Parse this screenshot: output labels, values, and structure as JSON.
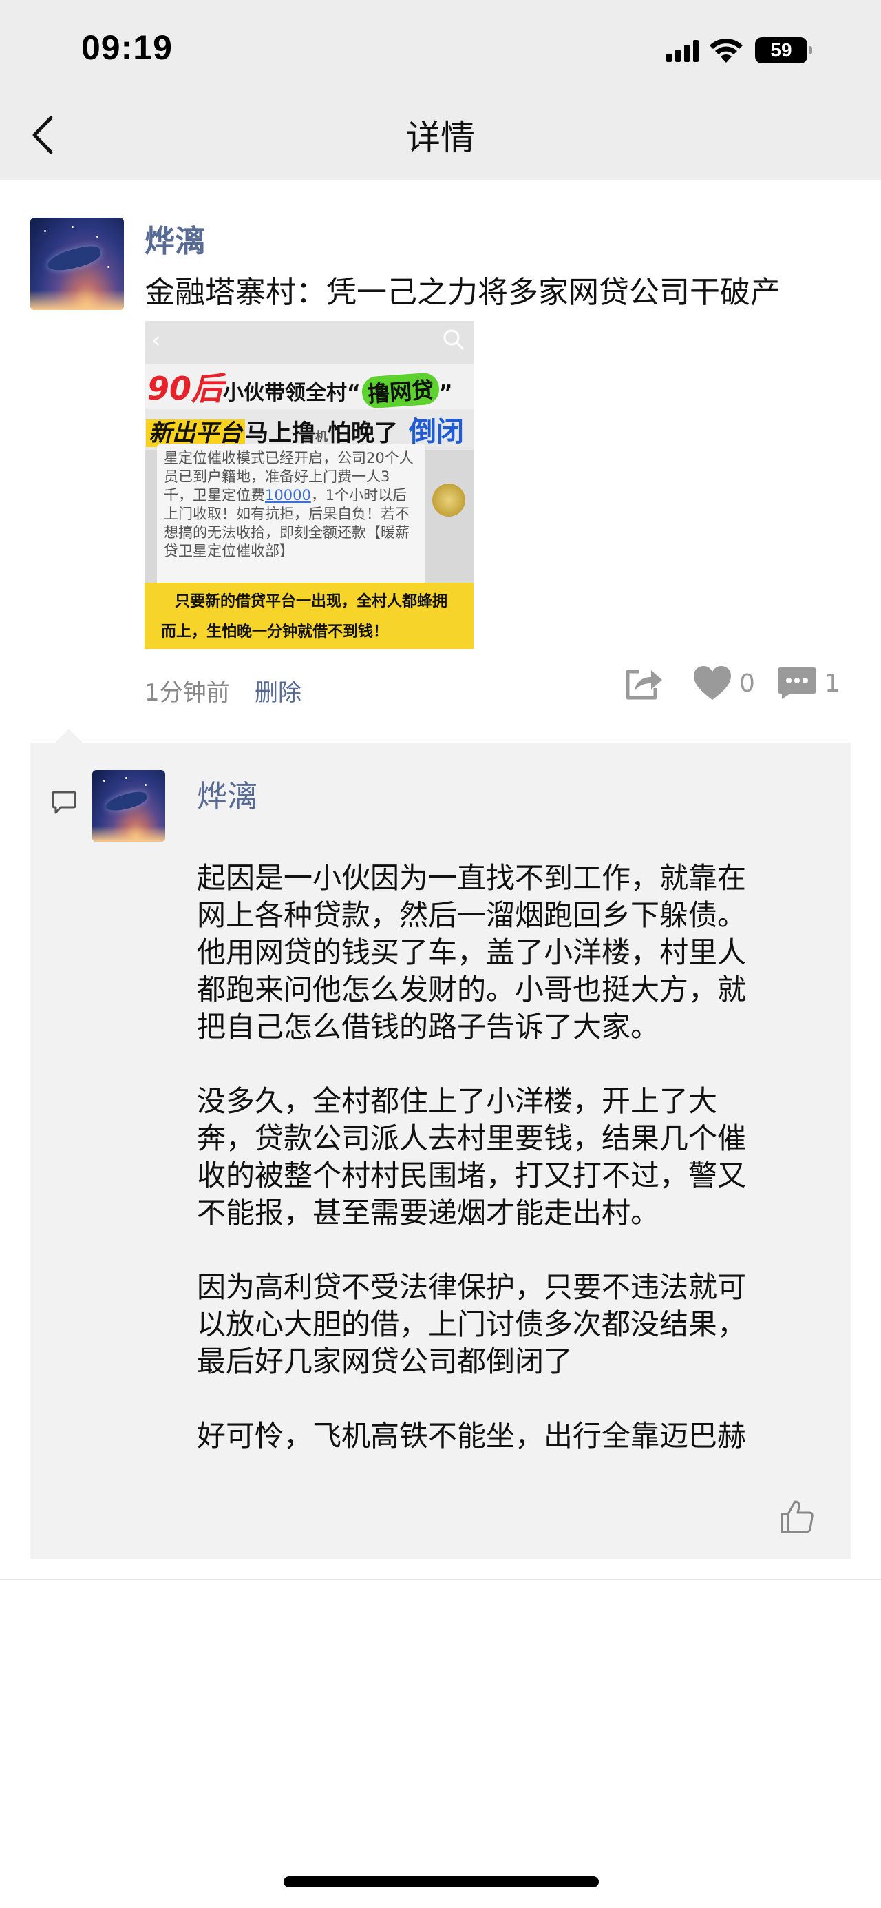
{
  "status_bar": {
    "time": "09:19",
    "battery": "59"
  },
  "nav": {
    "title": "详情"
  },
  "post": {
    "author": "烨漓",
    "text": "金融塔寨村：凭一己之力将多家网贷公司干破产",
    "timestamp": "1分钟前",
    "delete_label": "删除",
    "like_count": "0",
    "comment_count": "1",
    "image": {
      "headline_red": "90后",
      "headline_black": "小伙带领全村",
      "headline_green": "撸网贷",
      "subhead_yellow": "新出平台",
      "subhead_black": "马上撸",
      "subhead_small": "机",
      "subhead_black2": "怕晚了",
      "subhead_blue": "倒闭",
      "body_before": "星定位催收模式已经开启，公司20个人员已到户籍地，准备好上门费一人3千，卫星定位费",
      "body_highlight": "10000",
      "body_after": "，1个小时以后上门收取！如有抗拒，后果自负！若不想搞的无法收拾，即刻全额还款【暖薪贷卫星定位催收部】",
      "banner_line1": "只要新的借贷平台一出现，全村人都蜂拥",
      "banner_line2": "而上，生怕晚一分钟就借不到钱！"
    }
  },
  "comment": {
    "author": "烨漓",
    "paragraphs": [
      [
        "起因是一小伙因为一直找不到工作，就靠在",
        "网上各种贷款，然后一溜烟跑回乡下躲债。",
        "他用网贷的钱买了车，盖了小洋楼，村里人",
        "都跑来问他怎么发财的。小哥也挺大方，就",
        "把自己怎么借钱的路子告诉了大家。"
      ],
      [
        "没多久，全村都住上了小洋楼，开上了大",
        "奔，贷款公司派人去村里要钱，结果几个催",
        "收的被整个村村民围堵，打又打不过，警又",
        "不能报，甚至需要递烟才能走出村。"
      ],
      [
        "因为高利贷不受法律保护，只要不违法就可",
        "以放心大胆的借，上门讨债多次都没结果，",
        "最后好几家网贷公司都倒闭了"
      ],
      [
        "好可怜，飞机高铁不能坐，出行全靠迈巴赫"
      ]
    ]
  },
  "icons": {
    "back": "chevron-left-icon",
    "share": "share-icon",
    "like": "heart-icon",
    "comment": "comment-icon",
    "comment_marker": "comment-bubble-icon",
    "thumbs_up": "thumbs-up-icon"
  },
  "colors": {
    "link": "#576b95",
    "header_bg": "#ededed",
    "comment_bg": "#f2f2f2",
    "icon_gray": "#9a9a9a"
  }
}
